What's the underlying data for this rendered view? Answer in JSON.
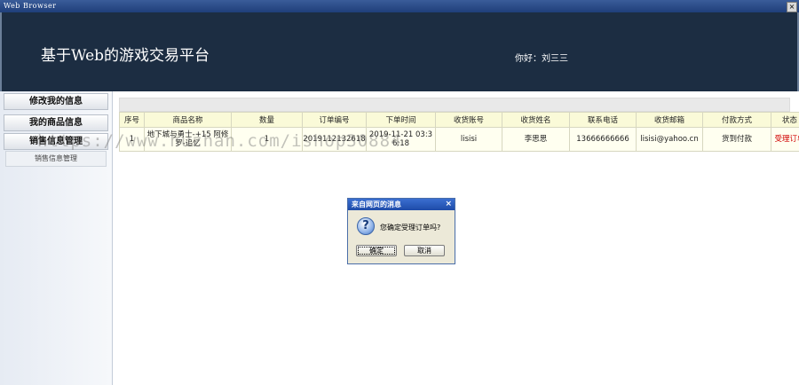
{
  "window": {
    "title": "Web Browser",
    "close": "×"
  },
  "header": {
    "site_title": "基于Web的游戏交易平台",
    "greeting": "你好：刘三三"
  },
  "sidebar": {
    "items": [
      {
        "label": "修改我的信息"
      },
      {
        "label": "我的商品信息"
      },
      {
        "label": "销售信息管理"
      }
    ],
    "sub_items": [
      {
        "label": "销售信息管理"
      }
    ]
  },
  "table": {
    "columns": [
      "序号",
      "商品名称",
      "数量",
      "订单编号",
      "下单时间",
      "收货账号",
      "收货姓名",
      "联系电话",
      "收货邮箱",
      "付款方式",
      "状态"
    ],
    "rows": [
      [
        "1",
        "地下城与勇士-+15 阿修罗-追忆",
        "1",
        "2019112132618",
        "2019-11-21 03:3 6:18",
        "lisisi",
        "李思思",
        "13666666666",
        "lisisi@yahoo.cn",
        "货到付款",
        "受理订单"
      ]
    ]
  },
  "watermark": "https://www.huzhan.com/ishop30884",
  "dialog": {
    "title": "来自网页的消息",
    "close": "×",
    "icon": "question-icon",
    "icon_glyph": "?",
    "message": "您确定受理订单吗?",
    "ok": "确定",
    "cancel": "取消"
  }
}
